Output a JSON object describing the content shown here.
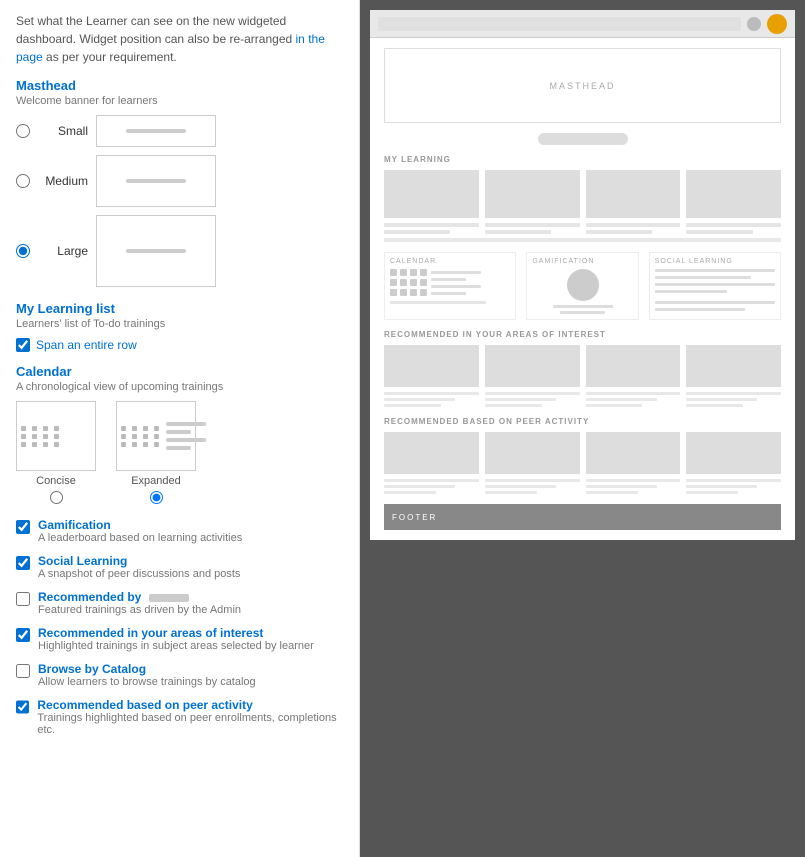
{
  "intro": {
    "text1": "Set what the Learner can see on the new widgeted dashboard. Widget position can also be re-arranged ",
    "link": "in the page",
    "text2": " as per your requirement."
  },
  "masthead": {
    "title": "Masthead",
    "desc": "Welcome banner for learners",
    "sizes": [
      "Small",
      "Medium",
      "Large"
    ]
  },
  "myLearning": {
    "title": "My Learning list",
    "desc": "Learners' list of To-do trainings",
    "spanLabel": "Span an entire row"
  },
  "calendar": {
    "title": "Calendar",
    "desc": "A chronological view of upcoming trainings",
    "options": [
      "Concise",
      "Expanded"
    ]
  },
  "checkboxes": [
    {
      "id": "gamification",
      "checked": true,
      "title": "Gamification",
      "desc": "A leaderboard based on learning activities"
    },
    {
      "id": "social",
      "checked": true,
      "title": "Social Learning",
      "desc": "A snapshot of peer discussions and posts"
    },
    {
      "id": "recommended-by",
      "checked": false,
      "title": "Recommended by",
      "desc": "Featured trainings as driven by the Admin"
    },
    {
      "id": "recommended-interest",
      "checked": true,
      "title": "Recommended in your areas of interest",
      "desc": "Highlighted trainings in subject areas selected by learner"
    },
    {
      "id": "browse-catalog",
      "checked": false,
      "title": "Browse by Catalog",
      "desc": "Allow learners to browse trainings by catalog"
    },
    {
      "id": "peer-activity",
      "checked": true,
      "title": "Recommended based on peer activity",
      "desc": "Trainings highlighted based on peer enrollments, completions etc."
    }
  ],
  "preview": {
    "masthead_label": "MASTHEAD",
    "my_learning_label": "MY LEARNING",
    "calendar_label": "CALENDAR",
    "gamification_label": "GAMIFICATION",
    "social_label": "SOCIAL LEARNING",
    "recommended_interest_label": "RECOMMENDED IN YOUR AREAS OF INTEREST",
    "recommended_peer_label": "RECOMMENDED BASED ON PEER ACTIVITY",
    "footer_label": "FOOTER"
  }
}
